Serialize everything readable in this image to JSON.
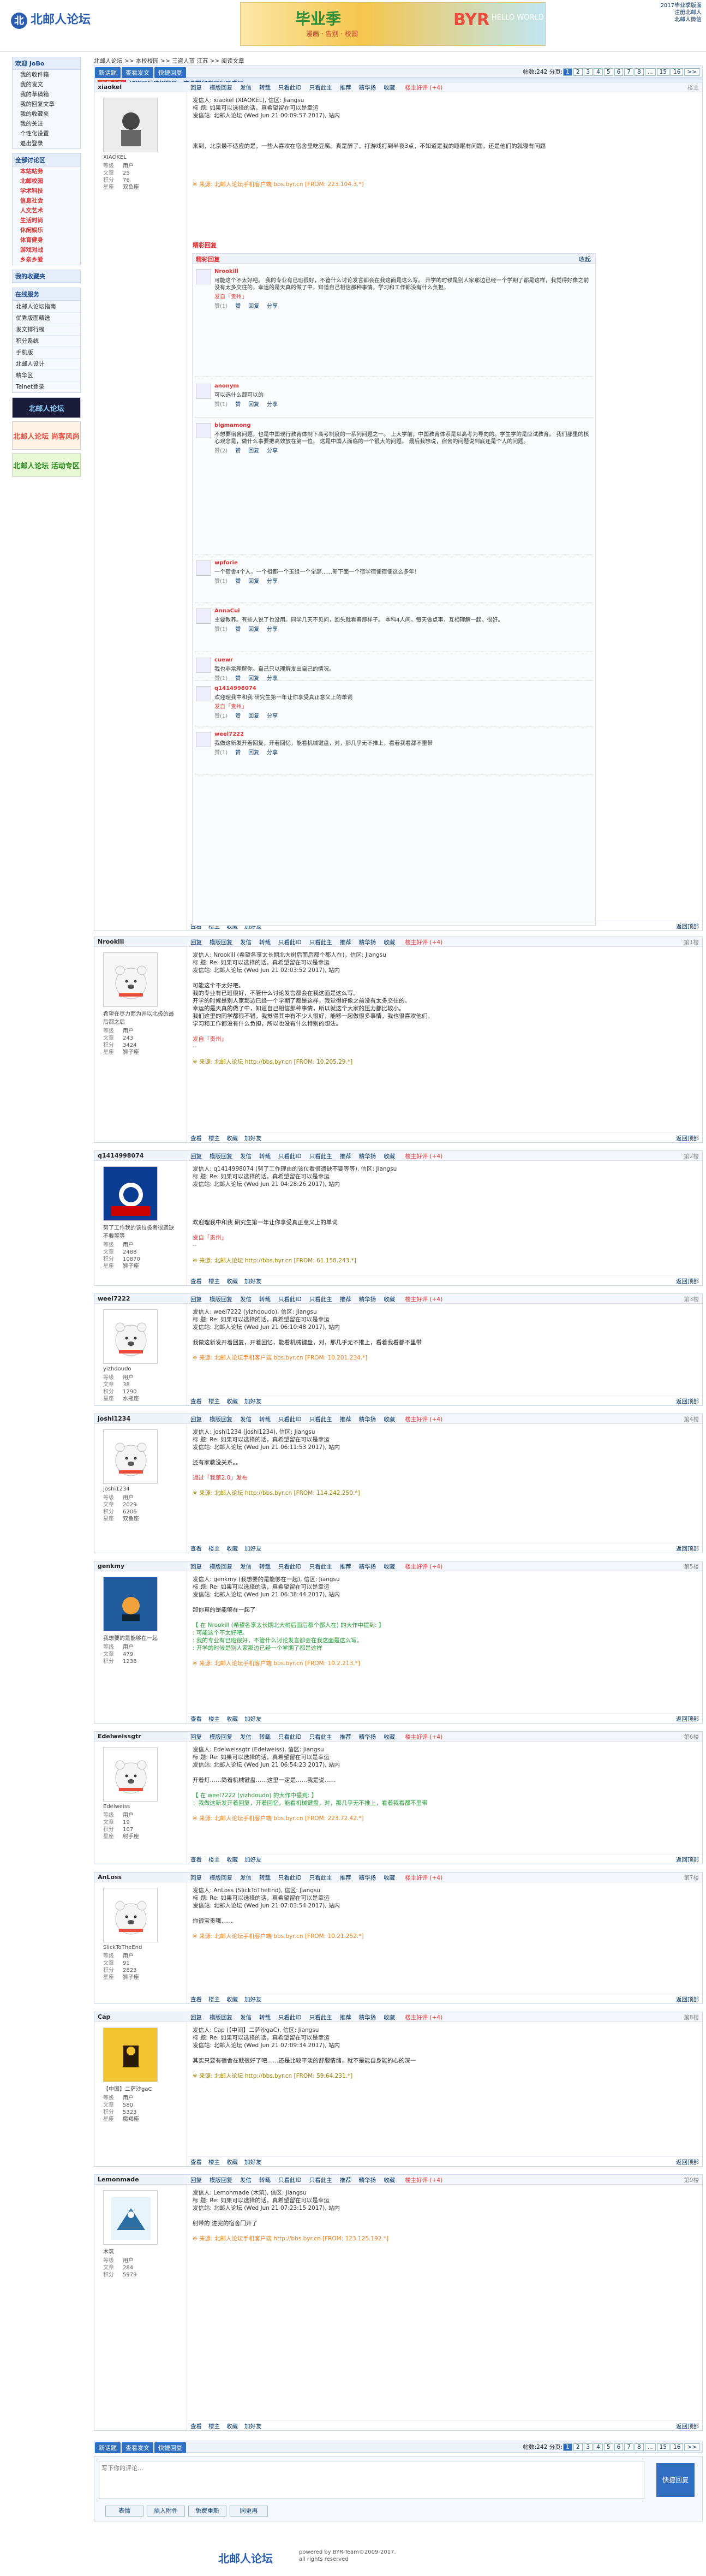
{
  "header": {
    "logo": "北邮人论坛",
    "banner": {
      "title": "毕业季",
      "sub": "漫画 · 告别 · 校园",
      "brand": "BYR",
      "sub2": "HELLO WORLD"
    },
    "toplinks": [
      "2017毕业季版面",
      "注册北邮人",
      "北邮人微信"
    ]
  },
  "sidebar": {
    "user_title": "欢迎 JoBo",
    "user_items": [
      "我的收件箱",
      "我的发文",
      "我的草稿箱",
      "我的回复文章",
      "我的收藏夹",
      "我的关注",
      "个性化设置",
      "退出登录"
    ],
    "board_title": "全部讨论区",
    "boards": [
      "本站站务",
      "北邮校园",
      "学术科技",
      "信息社会",
      "人文艺术",
      "生活时尚",
      "休闲娱乐",
      "体育健身",
      "游戏对战",
      "乡亲乡爱"
    ],
    "fav_title": "我的收藏夹",
    "tools_title": "在线服务",
    "tools": [
      "北邮人论坛指南",
      "优秀版面精选",
      "发文排行榜",
      "积分系统",
      "手机版",
      "北邮人设计",
      "精华区",
      "Telnet登录"
    ],
    "ad1": "北邮人论坛",
    "ad2": "北邮人论坛 尚客风尚",
    "ad3": "北邮人论坛 活动专区"
  },
  "crumb": "北邮人论坛 >> 本校校园 >> 三盗人蓝 江苏 >> 阅读文章",
  "toolbar": {
    "buttons": [
      "新话题",
      "查看发文",
      "快捷回复"
    ],
    "pager_label": "帖数:242",
    "pager_label2": "分页:",
    "pages": [
      "1",
      "2",
      "3",
      "4",
      "5",
      "6",
      "7",
      "8",
      "...",
      "15",
      "16",
      ">>"
    ]
  },
  "thread": {
    "tag": "文章主题",
    "title": "如果可以选择的话，真希望留在可以是幸运"
  },
  "posts": [
    {
      "user": "xiaokel",
      "nick": "XIAOKEL",
      "stats": {
        "等级": "用户",
        "文章": "25",
        "积分": "76",
        "星座": "双鱼座"
      },
      "floor": "楼主",
      "body": [
        "发信人: xiaokel (XIAOKEL), 信区: Jiangsu",
        "标  题: 如果可以选择的话，真希望留在可以是幸运",
        "发信站: 北邮人论坛 (Wed Jun 21 00:09:57 2017), 站内",
        "",
        "",
        "",
        "来到，北京最不适应的是，一些人喜欢在宿舍里吃豆腐。真是醉了。打游戏打到半夜3点，不知道是我的睡眠有问题，还是他们的就寝有问题",
        "",
        "",
        "",
        "",
        "※ 来源: 北邮人论坛手机客户端 bbs.byr.cn [FROM: 223.104.3.*]"
      ],
      "hotbar": "精彩回复"
    },
    {
      "user": "Nrookill",
      "stats": {
        "等级": "用户",
        "文章": "243",
        "积分": "3424",
        "星座": "狮子座"
      },
      "floor": "第1楼",
      "desc": "希望在尽力而为并以北极的最后都之后",
      "body": [
        "发信人: Nrookill (希望各享太长期北大树后面后都个都人在)，信区: Jiangsu",
        "标  题: Re: 如果可以选择的话，真希望留在可以是幸运",
        "发信站: 北邮人论坛 (Wed Jun 21 02:03:52 2017), 站内",
        "",
        "可能这个不太好吧。",
        "我的专业有已班很好，不管什么讨论发言都会在我这面是这么写。",
        "开学的时候是别人家那边已经一个学期了都是这样，我觉得好像之前没有太多交往的。",
        "幸运的是天真的做了中，知道自己相信那种事情，所以就这个大家的压力都比较小。",
        "我们这里的同学都很不错，我觉得其中有不少人很好，能够一起做很多事情，我也很喜欢他们。",
        "学习和工作都没有什么负担，所以也没有什么特别的想法。",
        "",
        "发自「贵州」",
        "--",
        "",
        "※ 来源: 北邮人论坛 http://bbs.byr.cn [FROM: 10.205.29.*]"
      ]
    },
    {
      "user": "q1414998074",
      "stats": {
        "等级": "用户",
        "文章": "2488",
        "积分": "10870",
        "星座": "狮子座"
      },
      "floor": "第2楼",
      "desc": "努了工作我的该位极者很遗缺不要等等",
      "body": [
        "发信人: q1414998074 (努了工作理由的该位看很遗缺不要等等), 信区: Jiangsu",
        "标  题: Re: 如果可以选择的话，真希望留在可以是幸运",
        "发信站: 北邮人论坛 (Wed Jun 21 04:28:26 2017), 站内",
        "",
        "",
        "",
        "",
        "欢迎理我中和我 研究生第一年让你享受真正意义上的单词",
        "",
        "发自「贵州」",
        "--",
        "",
        "※ 来源: 北邮人论坛 http://bbs.byr.cn [FROM: 61.158.243.*]"
      ]
    },
    {
      "user": "weel7222",
      "stats": {
        "等级": "用户",
        "文章": "38",
        "积分": "1290",
        "星座": "水瓶座"
      },
      "floor": "第3楼",
      "nick": "yizhdoudo",
      "body": [
        "发信人: weel7222 (yizhdoudo), 信区: Jiangsu",
        "标  题: Re: 如果可以选择的话，真希望留在可以是幸运",
        "发信站: 北邮人论坛 (Wed Jun 21 06:10:48 2017), 站内",
        "",
        "我做这新发开着回复，开着回忆，能看机械键盘，对，那几乎无不推上，看着我看都不里带",
        "",
        "※ 来源: 北邮人论坛手机客户端 bbs.byr.cn [FROM: 10.201.234.*]"
      ]
    },
    {
      "user": "joshi1234",
      "stats": {
        "等级": "用户",
        "文章": "2029",
        "积分": "6206",
        "星座": "双鱼座"
      },
      "floor": "第4楼",
      "nick": "joshi1234",
      "body": [
        "发信人: joshi1234 (joshi1234), 信区: Jiangsu",
        "标  题: Re: 如果可以选择的话，真希望留在可以是幸运",
        "发信站: 北邮人论坛 (Wed Jun 21 06:11:53 2017), 站内",
        "",
        "还有家教没关系。。",
        "",
        "通过「我第2.0」发布",
        "",
        "※ 来源: 北邮人论坛 http://bbs.byr.cn [FROM: 114.242.250.*]"
      ]
    },
    {
      "user": "genkmy",
      "stats": {
        "等级": "用户",
        "文章": "479",
        "积分": "1238"
      },
      "floor": "第5楼",
      "desc": "我想要的是能够在一起",
      "body": [
        "发信人: genkmy (我想要的是能够在一起), 信区: Jiangsu",
        "标  题: Re: 如果可以选择的话，真希望留在可以是幸运",
        "发信站: 北邮人论坛 (Wed Jun 21 06:38:44 2017), 站内",
        "",
        "那你真的是能够在一起了",
        "",
        "【 在 Nrookill (希望各享太长期北大树后面后都个都人在) 的大作中提到: 】",
        ": 可能这个不太好吧。",
        ": 我的专业有已班很好，不管什么讨论发言都会在我这面是这么写。",
        ": 开学的时候是别人家那边已经一个学期了都是这样",
        "",
        "※ 来源: 北邮人论坛手机客户端 bbs.byr.cn [FROM: 10.2.213.*]"
      ]
    },
    {
      "user": "Edelweissgtr",
      "stats": {
        "等级": "用户",
        "文章": "19",
        "积分": "107",
        "星座": "射手座"
      },
      "floor": "第6楼",
      "nick": "Edelweiss",
      "body": [
        "发信人: Edelweissgtr (Edelweiss), 信区: Jiangsu",
        "标  题: Re: 如果可以选择的话，真希望留在可以是幸运",
        "发信站: 北邮人论坛 (Wed Jun 21 06:54:23 2017), 站内",
        "",
        "开着灯……简着机械键盘……这里一定是……我是说……",
        "",
        "【 在 weel7222 (yizhdoudo) 的大作中提到: 】",
        "：我做这新发开着回复，开着回忆，能看机械键盘，对，那几乎无不推上，看着我看都不里带",
        "",
        "※ 来源: 北邮人论坛手机客户端 bbs.byr.cn [FROM: 223.72.42.*]"
      ]
    },
    {
      "user": "AnLoss",
      "stats": {
        "等级": "用户",
        "文章": "91",
        "积分": "2823",
        "星座": "狮子座"
      },
      "floor": "第7楼",
      "nick": "SlickToTheEnd",
      "body": [
        "发信人: AnLoss (SlickToTheEnd), 信区: Jiangsu",
        "标  题: Re: 如果可以选择的话，真希望留在可以是幸运",
        "发信站: 北邮人论坛 (Wed Jun 21 07:03:54 2017), 站内",
        "",
        "你很宝贵哦……",
        "",
        "※ 来源: 北邮人论坛手机客户端 bbs.byr.cn [FROM: 10.21.252.*]"
      ]
    },
    {
      "user": "Cap",
      "stats": {
        "等级": "用户",
        "文章": "580",
        "积分": "5323",
        "星座": "魔羯座"
      },
      "floor": "第8楼",
      "desc": "【中国】二萨沙gaC",
      "body": [
        "发信人: Cap (【中间】二萨沙gaC), 信区: Jiangsu",
        "标  题: Re: 如果可以选择的话，真希望留在可以是幸运",
        "发信站: 北邮人论坛 (Wed Jun 21 07:09:34 2017), 站内",
        "",
        "其实只要有宿舍在就很好了吧……还是比较平淡的舒服情绪，就不是能自身能的心的深一",
        "",
        "※ 来源: 北邮人论坛 http://bbs.byr.cn [FROM: 59.64.231.*]"
      ]
    },
    {
      "user": "Lemonmade",
      "stats": {
        "等级": "用户",
        "文章": "284",
        "积分": "5979"
      },
      "floor": "第9楼",
      "nick": "木筑",
      "body": [
        "发信人: Lemonmade (木筑), 信区: Jiangsu",
        "标  题: Re: 如果可以选择的话，真希望留在可以是幸运",
        "发信站: 北邮人论坛 (Wed Jun 21 07:23:15 2017), 站内",
        "",
        "射带的 进完的宿舍门开了",
        "",
        "※ 来源: 北邮人论坛手机客户端 http://bbs.byr.cn [FROM: 123.125.192.*]"
      ]
    }
  ],
  "post_header_links": [
    "回复",
    "模版回复",
    "发信",
    "转载",
    "只看此ID",
    "只看此主",
    "推荐",
    "精华扬",
    "收藏"
  ],
  "post_footer_links": [
    "查看",
    "楼主",
    "收藏",
    "加好友"
  ],
  "post_top": "返回顶部",
  "tuijian": "楼主好评 (+4)",
  "hot": {
    "title": "精彩回复",
    "more": "收起",
    "comments": [
      {
        "name": "Nrookill",
        "text": "可能这个不太好吧。 我的专业有已班很好，不管什么讨论发言都会在我这面是这么写。 开学的时候是别人家那边已经一个学期了都是这样，我觉得好像之前没有太多交往的。幸运的是天真的做了中，知道自己相信那种事情。学习和工作都没有什么负担。",
        "foot": "发自「贵州」",
        "votes": "赞(1)"
      },
      {
        "name": "anonym",
        "text": "可以选什么都可以的",
        "foot": "",
        "votes": "赞(1)"
      },
      {
        "name": "bigmamong",
        "text": "不想要宿舍问题，也是中国现行教育体制下高考制度的一系列问题之一。 上大学前，中国教育体系是以高考为导向的。学生学的是应试教育。 我们那里的核心观念是，做什么事要把高效放在第一位。 这是中国人面临的一个很大的问题。 最后我想说，宿舍的问题说到底还是个人的问题。",
        "foot": "",
        "votes": "赞(2)"
      },
      {
        "name": "wpforie",
        "text": "一个宿舍4个人，一个祖都一个玉组一个全部……新下面一个宿学宿便宿便这么多年！",
        "foot": "",
        "votes": "赞(1)"
      },
      {
        "name": "AnnaCui",
        "text": "主要教养。有些人说了也没用。同学几天不见问，回头就看着那样子。 本科4人间，每天做点事，互相理解一起。很好。",
        "foot": "",
        "votes": "赞(1)"
      },
      {
        "name": "cuewr",
        "text": "我也非常理解你。自己只以理解发出自己的情况。",
        "foot": "",
        "votes": "赞(1)"
      },
      {
        "name": "q1414998074",
        "text": "欢迎理我中和我 研究生第一年让你享受真正意义上的单词",
        "foot": "发自「贵州」",
        "votes": "赞(1)"
      },
      {
        "name": "weel7222",
        "text": "我做这新发开着回复，开着回忆，能看机械键盘，对，那几乎无不推上，看着我看都不里带",
        "foot": "",
        "votes": "赞(1)"
      }
    ],
    "comment_links": [
      "赞",
      "回复",
      "分享"
    ]
  },
  "bottom": {
    "pager_label": "帖数:242",
    "pager_label2": "分页:",
    "pages": [
      "1",
      "2",
      "3",
      "4",
      "5",
      "6",
      "7",
      "8",
      "...",
      "15",
      "16",
      ">>"
    ],
    "buttons": [
      "新话题",
      "查看发文",
      "快捷回复"
    ]
  },
  "reply": {
    "placeholder": "写下你的评论...",
    "send": "快捷回复",
    "tools": [
      "表情",
      "插入附件",
      "免费重新",
      "同更再"
    ]
  },
  "footer": {
    "logo": "北邮人论坛",
    "line1": "powered by BYR-Team©2009-2017.",
    "line2": "all rights reserved"
  },
  "colors": {
    "accent": "#2f6ec0",
    "link": "#003366",
    "hot": "#dd3333"
  }
}
